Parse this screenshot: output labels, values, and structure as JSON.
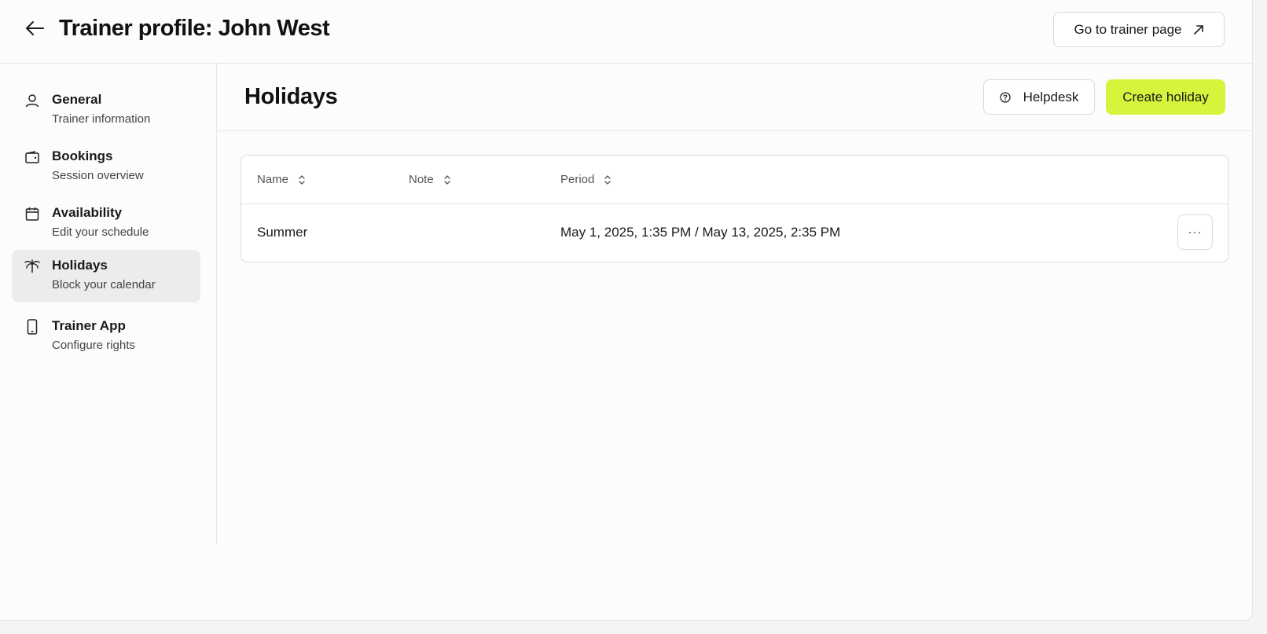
{
  "header": {
    "title": "Trainer profile: John West",
    "trainer_page_button": "Go to trainer page"
  },
  "sidebar": {
    "items": [
      {
        "label": "General",
        "sub": "Trainer information",
        "icon": "user-icon"
      },
      {
        "label": "Bookings",
        "sub": "Session overview",
        "icon": "wallet-icon"
      },
      {
        "label": "Availability",
        "sub": "Edit your schedule",
        "icon": "calendar-icon"
      },
      {
        "label": "Holidays",
        "sub": "Block your calendar",
        "icon": "palm-tree-icon",
        "active": true
      },
      {
        "label": "Trainer App",
        "sub": "Configure rights",
        "icon": "phone-icon"
      }
    ]
  },
  "main": {
    "title": "Holidays",
    "helpdesk_button": "Helpdesk",
    "create_button": "Create holiday",
    "accent_color": "#d4f53c",
    "table": {
      "columns": [
        "Name",
        "Note",
        "Period"
      ],
      "rows": [
        {
          "name": "Summer",
          "note": "",
          "period": "May 1, 2025, 1:35 PM / May 13, 2025, 2:35 PM"
        }
      ],
      "row_menu_label": "···"
    }
  }
}
